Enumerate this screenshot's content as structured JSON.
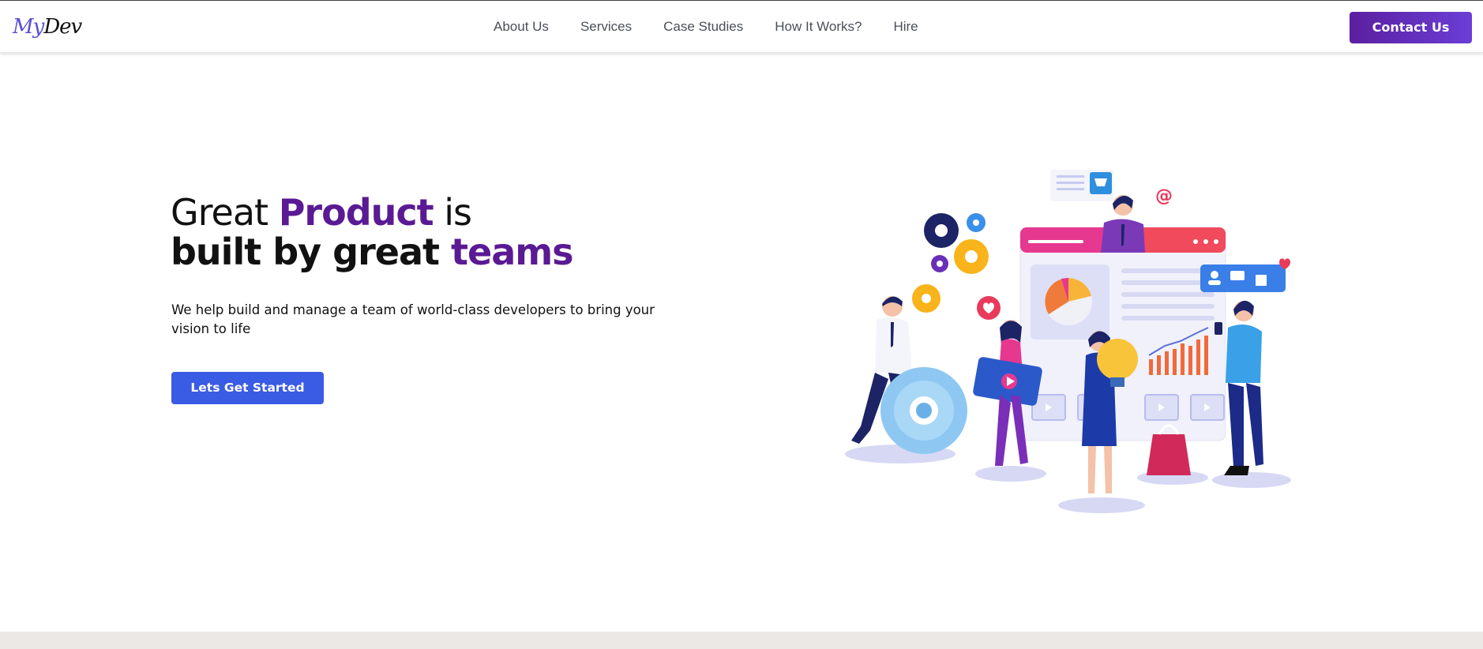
{
  "logo": {
    "part1": "My",
    "part2": "Dev"
  },
  "nav": {
    "links": [
      "About Us",
      "Services",
      "Case Studies",
      "How It Works?",
      "Hire"
    ],
    "contact_label": "Contact Us"
  },
  "hero": {
    "title_word1": "Great",
    "title_word2": "Product",
    "title_word3": "is",
    "title_line2_a": "built by great",
    "title_line2_b": "teams",
    "subtitle": "We help build and manage a team of world-class developers to bring your vision to life",
    "cta_label": "Lets Get Started",
    "illustration_icon": "team-collaboration-illustration",
    "illustration_email_glyph": "@"
  },
  "colors": {
    "accent": "#5a1a94",
    "cta": "#3a5be3",
    "contact_gradient_start": "#5b1fa0",
    "contact_gradient_end": "#6b3ed6"
  }
}
